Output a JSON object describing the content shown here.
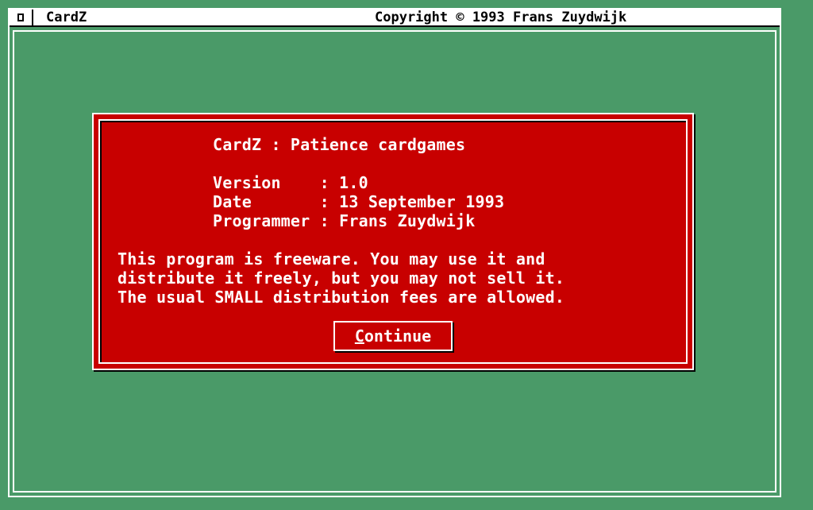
{
  "window": {
    "title": "CardZ",
    "copyright": "Copyright © 1993 Frans Zuydwijk"
  },
  "dialog": {
    "heading": "CardZ : Patience cardgames",
    "info": [
      {
        "label": "Version    ",
        "value": ": 1.0"
      },
      {
        "label": "Date       ",
        "value": ": 13 September 1993"
      },
      {
        "label": "Programmer ",
        "value": ": Frans Zuydwijk"
      }
    ],
    "message": [
      "This program is freeware. You may use it and",
      "distribute it freely, but you may not sell it.",
      "The usual SMALL distribution fees are allowed."
    ],
    "continue_hotkey": "C",
    "continue_rest": "ontinue"
  },
  "colors": {
    "desktop": "#4a9a68",
    "dialog": "#c80000",
    "text": "#ffffff"
  },
  "icons": {
    "close": "close-box-icon"
  }
}
